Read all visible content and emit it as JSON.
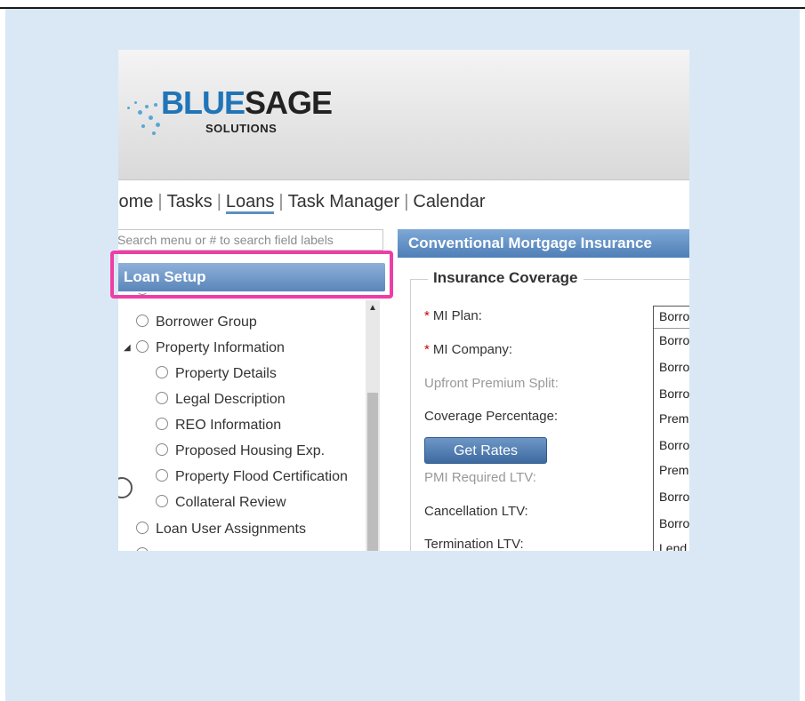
{
  "logo": {
    "word_blue": "BLUE",
    "word_dark": "SAGE",
    "sub": "SOLUTIONS"
  },
  "nav": {
    "items": [
      "Home",
      "Tasks",
      "Loans",
      "Task Manager",
      "Calendar"
    ],
    "active": "Loans",
    "visible_text": [
      "lome",
      "Tasks",
      "Loans",
      "Task Manager",
      "Calendar"
    ]
  },
  "search": {
    "placeholder": "Search menu or # to search field labels",
    "visible_text": "Search menu or # to search field labels"
  },
  "sidebar": {
    "header": "Loan Setup",
    "items": [
      {
        "label": "Borrower Group",
        "level": 0
      },
      {
        "label": "Property Information",
        "level": 0,
        "expanded": true
      },
      {
        "label": "Property Details",
        "level": 1
      },
      {
        "label": "Legal Description",
        "level": 1
      },
      {
        "label": "REO Information",
        "level": 1
      },
      {
        "label": "Proposed Housing Exp.",
        "level": 1
      },
      {
        "label": "Property Flood Certification",
        "level": 1
      },
      {
        "label": "Collateral Review",
        "level": 1
      },
      {
        "label": "Loan User Assignments",
        "level": 0
      }
    ]
  },
  "panel": {
    "title": "Conventional Mortgage Insurance",
    "section": "Insurance Coverage",
    "fields": {
      "mi_plan": "MI Plan:",
      "mi_company": "MI Company:",
      "upfront_split": "Upfront Premium Split:",
      "coverage_pct": "Coverage Percentage:",
      "pmi_ltv": "PMI Required LTV:",
      "cancel_ltv": "Cancellation LTV:",
      "term_ltv": "Termination LTV:"
    },
    "get_rates": "Get Rates",
    "mi_plan_value": "Borro",
    "dropdown_options": [
      "Borro",
      "Borro",
      "Borro",
      "Prem",
      "Borro",
      "Prem",
      "Borro",
      "Borro",
      "Lend"
    ]
  },
  "colors": {
    "frame_bg": "#dae8f6",
    "highlight": "#ee3ea6",
    "accent": "#4f7fb7"
  }
}
